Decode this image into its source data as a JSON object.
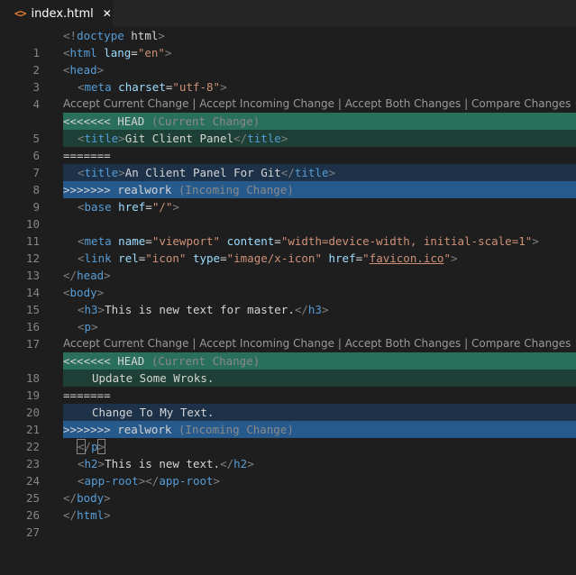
{
  "tab": {
    "icon": "<>",
    "title": "index.html",
    "close": "✕"
  },
  "codelens": {
    "accept_current": "Accept Current Change",
    "accept_incoming": "Accept Incoming Change",
    "accept_both": "Accept Both Changes",
    "compare": "Compare Changes",
    "sep": " | "
  },
  "markers": {
    "head": "<<<<<<< HEAD",
    "current_hint": "(Current Change)",
    "divider": "=======",
    "incoming": ">>>>>>> realwork",
    "incoming_hint": "(Incoming Change)"
  },
  "lines": {
    "l1": "<!doctype html>",
    "l2_tag": "html",
    "l2_attr": "lang",
    "l2_val": "\"en\"",
    "l3_tag": "head",
    "l4_tag": "meta",
    "l4_attr": "charset",
    "l4_val": "\"utf-8\"",
    "l6_tag": "title",
    "l6_text": "Git Client Panel",
    "l8_text": "An Client Panel For Git",
    "l10_tag": "base",
    "l10_attr": "href",
    "l10_val": "\"/\"",
    "l12_attr1": "name",
    "l12_val1": "\"viewport\"",
    "l12_attr2": "content",
    "l12_val2": "\"width=device-width, initial-scale=1\"",
    "l13_tag": "link",
    "l13_attr1": "rel",
    "l13_val1": "\"icon\"",
    "l13_attr2": "type",
    "l13_val2": "\"image/x-icon\"",
    "l13_attr3": "href",
    "l13_val3": "favicon.ico",
    "l15_tag": "body",
    "l16_tag": "h3",
    "l16_text": "This is new text for master.",
    "l17_tag": "p",
    "l19_text": "Update Some Wroks.",
    "l21_text": "Change To My Text.",
    "l24_tag": "h2",
    "l24_text": "This is new text.",
    "l25_tag": "app-root"
  },
  "line_numbers": [
    "1",
    "2",
    "3",
    "4",
    "5",
    "6",
    "7",
    "8",
    "9",
    "10",
    "11",
    "12",
    "13",
    "14",
    "15",
    "16",
    "17",
    "18",
    "19",
    "20",
    "21",
    "22",
    "23",
    "24",
    "25",
    "26",
    "27"
  ]
}
